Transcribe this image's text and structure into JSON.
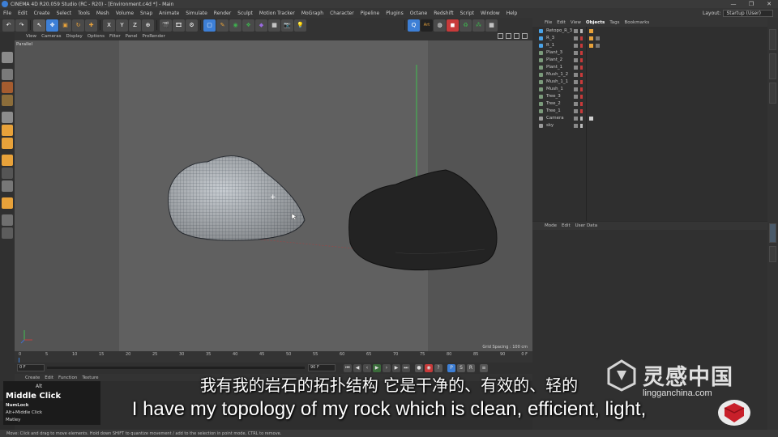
{
  "window": {
    "title": "CINEMA 4D R20.059 Studio (RC - R20) - [Environment.c4d *] - Main",
    "controls": [
      "—",
      "❐",
      "✕"
    ]
  },
  "menubar": {
    "items": [
      "File",
      "Edit",
      "Create",
      "Select",
      "Tools",
      "Mesh",
      "Volume",
      "Snap",
      "Animate",
      "Simulate",
      "Render",
      "Sculpt",
      "Motion Tracker",
      "MoGraph",
      "Character",
      "Pipeline",
      "Plugins",
      "Octane",
      "Redshift",
      "Script",
      "Window",
      "Help"
    ],
    "layout_label": "Layout:",
    "layout_value": "Startup (User)"
  },
  "toolbar": {
    "axis_buttons": [
      "X",
      "Y",
      "Z"
    ],
    "colors": {
      "blue": "#3d7fd6",
      "orange": "#e8a23a",
      "green": "#3fae4e",
      "red": "#c83a3a"
    }
  },
  "viewport": {
    "menu": [
      "View",
      "Cameras",
      "Display",
      "Options",
      "Filter",
      "Panel",
      "ProRender"
    ],
    "camera_label": "Parallel",
    "grid_spacing": "Grid Spacing : 100 cm"
  },
  "timeline": {
    "ticks": [
      "0",
      "5",
      "10",
      "15",
      "20",
      "25",
      "30",
      "35",
      "40",
      "45",
      "50",
      "55",
      "60",
      "65",
      "70",
      "75",
      "80",
      "85",
      "90"
    ],
    "current": "0 F"
  },
  "playback": {
    "start_field": "0 F",
    "end_field": "90 F"
  },
  "material_manager": {
    "menu": [
      "Create",
      "Edit",
      "Function",
      "Texture"
    ]
  },
  "key_overlay": {
    "modifier": "Alt",
    "action": "Middle Click",
    "line1": "NumLock",
    "line2": "Alt+Middle Click",
    "line3": "Matley"
  },
  "statusbar": {
    "text": "Move: Click and drag to move elements. Hold down SHIFT to quantize movement / add to the selection in point mode, CTRL to remove."
  },
  "object_manager": {
    "menu": [
      "File",
      "Edit",
      "View",
      "Objects",
      "Tags",
      "Bookmarks"
    ],
    "active_menu": "Objects",
    "objects": [
      {
        "name": "Retopo_R_3",
        "icon": "#4aa3e8"
      },
      {
        "name": "R_3",
        "icon": "#4aa3e8"
      },
      {
        "name": "R_1",
        "icon": "#4aa3e8"
      },
      {
        "name": "Plant_3",
        "icon": "#7b9a7b"
      },
      {
        "name": "Plant_2",
        "icon": "#7b9a7b"
      },
      {
        "name": "Plant_1",
        "icon": "#7b9a7b"
      },
      {
        "name": "Mush_1_2",
        "icon": "#7b9a7b"
      },
      {
        "name": "Mush_1_1",
        "icon": "#7b9a7b"
      },
      {
        "name": "Mush_1",
        "icon": "#7b9a7b"
      },
      {
        "name": "Tree_3",
        "icon": "#7b9a7b"
      },
      {
        "name": "Tree_2",
        "icon": "#7b9a7b"
      },
      {
        "name": "Tree_1",
        "icon": "#7b9a7b"
      },
      {
        "name": "Camera",
        "icon": "#9a9a9a"
      },
      {
        "name": "sky",
        "icon": "#9a9a9a"
      }
    ]
  },
  "attribute_manager": {
    "menu": [
      "Mode",
      "Edit",
      "User Data"
    ]
  },
  "subtitles": {
    "chinese": "我有我的岩石的拓扑结构  它是干净的、有效的、轻的",
    "english": "I have my topology of my rock which is clean, efficient, light,"
  },
  "watermark": {
    "name": "灵感中国",
    "url": "lingganchina.com"
  }
}
